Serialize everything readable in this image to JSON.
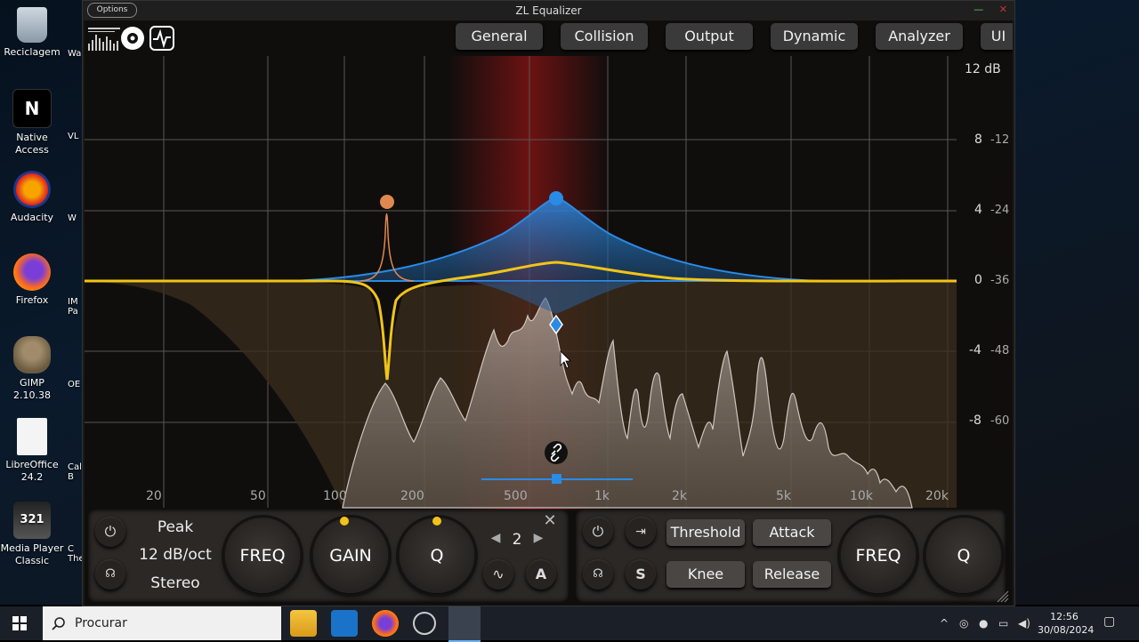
{
  "desktop": {
    "icons": [
      {
        "label": "Reciclagem"
      },
      {
        "label": "Native Access"
      },
      {
        "label": "Audacity"
      },
      {
        "label": "Firefox"
      },
      {
        "label": "GIMP 2.10.38"
      },
      {
        "label": "LibreOffice 24.2"
      },
      {
        "label": "Media Player Classic"
      }
    ],
    "partial_labels": [
      "Wa",
      "VL",
      "W",
      "IM Pa",
      "OE",
      "Cal B",
      "C The"
    ]
  },
  "window": {
    "title": "ZL Equalizer",
    "options_label": "Options",
    "controls": {
      "minimize": "—",
      "close": "✕"
    }
  },
  "tabs": [
    "General",
    "Collision",
    "Output",
    "Dynamic",
    "Analyzer",
    "UI"
  ],
  "analyzer": {
    "db_labels": [
      "12 dB",
      "8",
      "4",
      "0",
      "-4",
      "-8"
    ],
    "level_labels": [
      "-12",
      "-24",
      "-36",
      "-48",
      "-60"
    ],
    "freq_labels": [
      "20",
      "50",
      "100",
      "200",
      "500",
      "1k",
      "2k",
      "5k",
      "10k",
      "20k"
    ],
    "bands": [
      {
        "name": "peak-band-blue",
        "color": "#2a8be6",
        "freq_hz": 1150,
        "gain_db": 4.6
      },
      {
        "name": "notch-band-orange",
        "color": "#e08850",
        "freq_hz": 240,
        "gain_db": 4.5
      },
      {
        "name": "yellow-curve",
        "color": "#f2c418",
        "freq_hz": 240,
        "gain_db": -5.5
      }
    ],
    "colors": {
      "accent": "#2a8be6",
      "curve": "#f2c418",
      "red_glow": "#8a1414"
    }
  },
  "band_panel": {
    "filter_type": "Peak",
    "slope": "12 dB/oct",
    "stereo_mode": "Stereo",
    "knobs": [
      "FREQ",
      "GAIN",
      "Q"
    ],
    "band_index": "2",
    "close_label": "✕",
    "prev": "◀",
    "next": "▶",
    "dynamic_toggle": "∿",
    "auto_label": "A"
  },
  "dynamic_panel": {
    "buttons": [
      "Threshold",
      "Attack",
      "Knee",
      "Release"
    ],
    "knobs": [
      "FREQ",
      "Q"
    ],
    "side_label": "S"
  },
  "taskbar": {
    "search_placeholder": "Procurar",
    "time": "12:56",
    "date": "30/08/2024"
  }
}
